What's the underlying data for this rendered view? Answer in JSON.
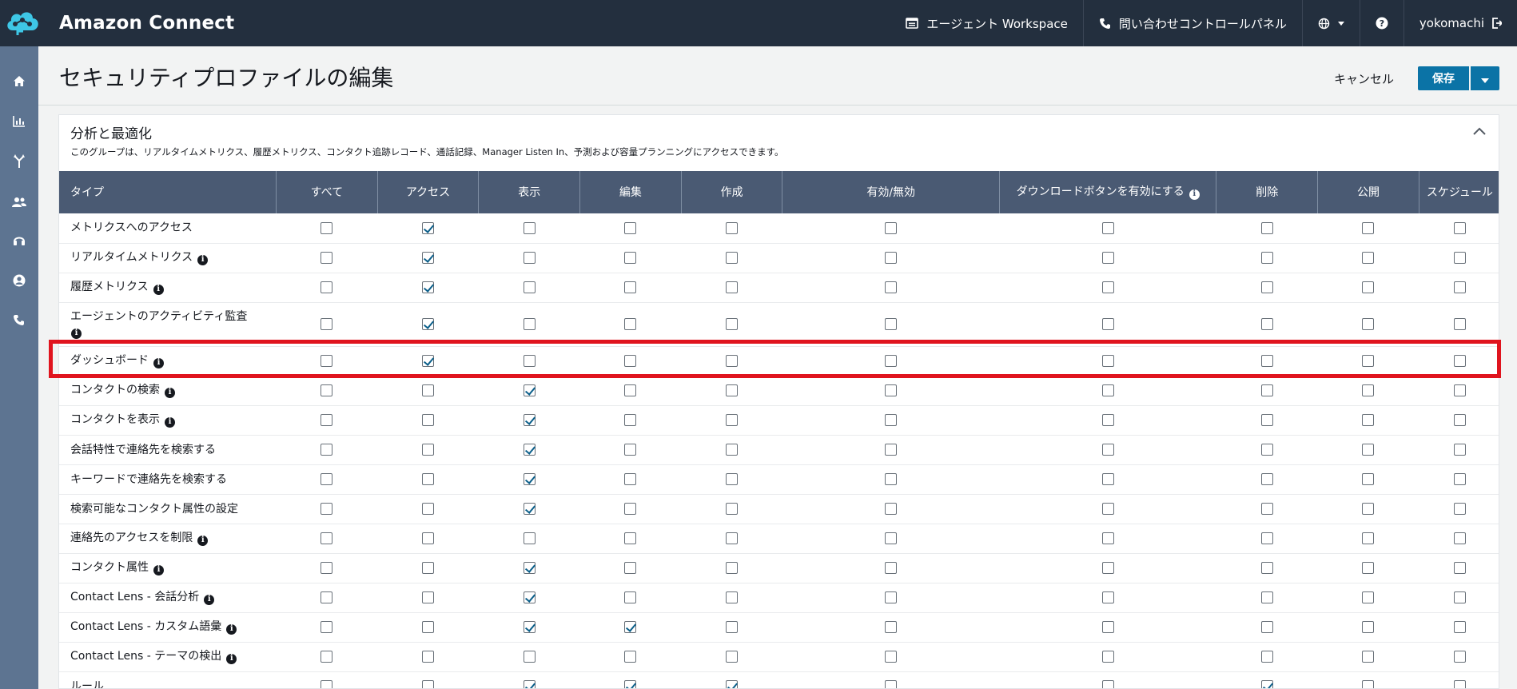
{
  "app": {
    "title": "Amazon Connect"
  },
  "topbar": {
    "agent_workspace": "エージェント Workspace",
    "contact_control_panel": "問い合わせコントロールパネル",
    "user": "yokomachi"
  },
  "sidenav": [
    "home",
    "metrics",
    "routing",
    "users",
    "channels",
    "profile",
    "phone"
  ],
  "header": {
    "title": "セキュリティプロファイルの編集",
    "cancel_label": "キャンセル",
    "save_label": "保存"
  },
  "section": {
    "title": "分析と最適化",
    "description": "このグループは、リアルタイムメトリクス、履歴メトリクス、コンタクト追跡レコード、通話記録、Manager Listen In、予測および容量プランニングにアクセスできます。"
  },
  "table": {
    "columns": [
      "タイプ",
      "すべて",
      "アクセス",
      "表示",
      "編集",
      "作成",
      "有効/無効",
      "ダウンロードボタンを有効にする",
      "削除",
      "公開",
      "スケジュール"
    ],
    "rows": [
      {
        "type": "メトリクスへのアクセス",
        "info": false,
        "checks": [
          0,
          1,
          0,
          0,
          0,
          0,
          0,
          0,
          0,
          0
        ]
      },
      {
        "type": "リアルタイムメトリクス",
        "info": true,
        "checks": [
          0,
          1,
          0,
          0,
          0,
          0,
          0,
          0,
          0,
          0
        ]
      },
      {
        "type": "履歴メトリクス",
        "info": true,
        "checks": [
          0,
          1,
          0,
          0,
          0,
          0,
          0,
          0,
          0,
          0
        ]
      },
      {
        "type": "エージェントのアクティビティ監査",
        "info": true,
        "checks": [
          0,
          1,
          0,
          0,
          0,
          0,
          0,
          0,
          0,
          0
        ]
      },
      {
        "type": "ダッシュボード",
        "info": true,
        "checks": [
          0,
          1,
          0,
          0,
          0,
          0,
          0,
          0,
          0,
          0
        ]
      },
      {
        "type": "コンタクトの検索",
        "info": true,
        "checks": [
          0,
          0,
          1,
          0,
          0,
          0,
          0,
          0,
          0,
          0
        ]
      },
      {
        "type": "コンタクトを表示",
        "info": true,
        "checks": [
          0,
          0,
          1,
          0,
          0,
          0,
          0,
          0,
          0,
          0
        ]
      },
      {
        "type": "会話特性で連絡先を検索する",
        "info": false,
        "checks": [
          0,
          0,
          1,
          0,
          0,
          0,
          0,
          0,
          0,
          0
        ]
      },
      {
        "type": "キーワードで連絡先を検索する",
        "info": false,
        "checks": [
          0,
          0,
          1,
          0,
          0,
          0,
          0,
          0,
          0,
          0
        ]
      },
      {
        "type": "検索可能なコンタクト属性の設定",
        "info": false,
        "checks": [
          0,
          0,
          1,
          0,
          0,
          0,
          0,
          0,
          0,
          0
        ]
      },
      {
        "type": "連絡先のアクセスを制限",
        "info": true,
        "checks": [
          0,
          0,
          0,
          0,
          0,
          0,
          0,
          0,
          0,
          0
        ]
      },
      {
        "type": "コンタクト属性",
        "info": true,
        "checks": [
          0,
          0,
          1,
          0,
          0,
          0,
          0,
          0,
          0,
          0
        ]
      },
      {
        "type": "Contact Lens - 会話分析",
        "info": true,
        "checks": [
          0,
          0,
          1,
          0,
          0,
          0,
          0,
          0,
          0,
          0
        ]
      },
      {
        "type": "Contact Lens - カスタム語彙",
        "info": true,
        "checks": [
          0,
          0,
          1,
          1,
          0,
          0,
          0,
          0,
          0,
          0
        ]
      },
      {
        "type": "Contact Lens - テーマの検出",
        "info": true,
        "checks": [
          0,
          0,
          0,
          0,
          0,
          0,
          0,
          0,
          0,
          0
        ]
      },
      {
        "type": "ルール",
        "info": false,
        "checks": [
          0,
          0,
          1,
          1,
          1,
          0,
          0,
          1,
          0,
          0
        ]
      }
    ]
  },
  "highlighted_row": "ダッシュボード"
}
